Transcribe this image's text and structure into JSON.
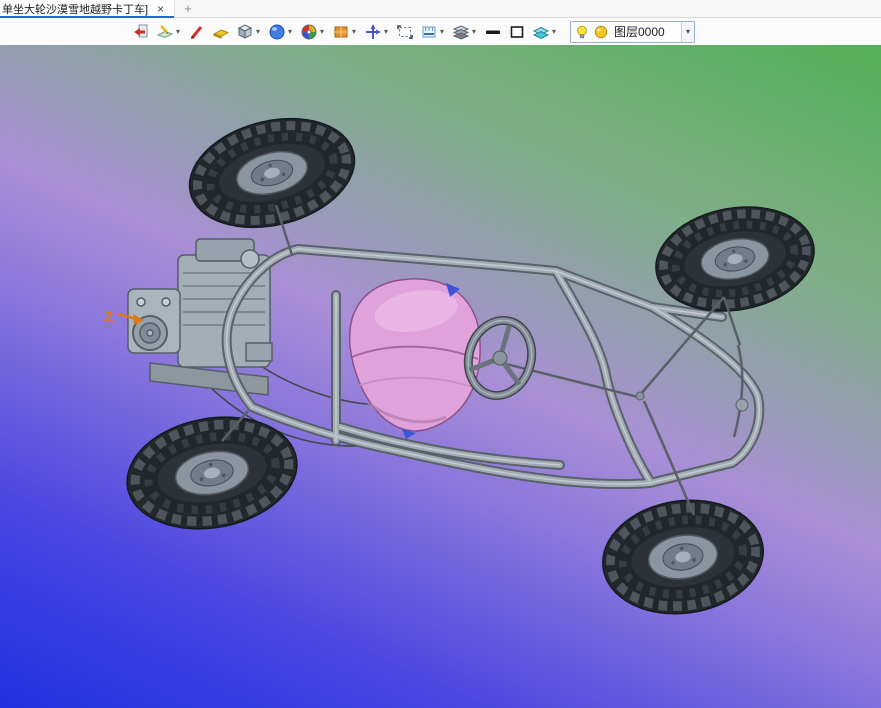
{
  "tabbar": {
    "tab_title": "单坐大轮沙漠雪地越野卡丁车]",
    "close_glyph": "×",
    "new_tab_glyph": "+"
  },
  "toolbar": {
    "dropdown_glyph": "▾",
    "layer_selector": {
      "value": "图层0000"
    },
    "icons": [
      {
        "name": "exit-to-sheet-icon",
        "dropdown": false
      },
      {
        "name": "render-pencil-icon",
        "dropdown": true
      },
      {
        "name": "red-pen-icon",
        "dropdown": false
      },
      {
        "name": "gold-sheet-icon",
        "dropdown": false
      },
      {
        "name": "cube-display-icon",
        "dropdown": true
      },
      {
        "name": "sphere-render-icon",
        "dropdown": true
      },
      {
        "name": "color-wheel-icon",
        "dropdown": true
      },
      {
        "name": "orange-box-icon",
        "dropdown": true
      },
      {
        "name": "navigate-compass-icon",
        "dropdown": true
      },
      {
        "name": "selection-box-icon",
        "dropdown": false
      },
      {
        "name": "measure-grid-icon",
        "dropdown": true
      },
      {
        "name": "layers-stack-icon",
        "dropdown": true
      },
      {
        "name": "line-width-icon",
        "dropdown": false
      },
      {
        "name": "fill-swatch-icon",
        "dropdown": false
      },
      {
        "name": "cyan-sheets-icon",
        "dropdown": true
      }
    ]
  },
  "viewport": {
    "axis_label": "Z"
  },
  "colors": {
    "tab_accent": "#1f6ad0",
    "bg_bottom_left": "#2131e2",
    "bg_middle": "#a98fd6",
    "bg_top_right": "#52b055",
    "seat_pink": "#dfa2db",
    "frame_gray": "#a2abb4",
    "tire_dark": "#22272c",
    "axis_orange": "#e0761a"
  }
}
